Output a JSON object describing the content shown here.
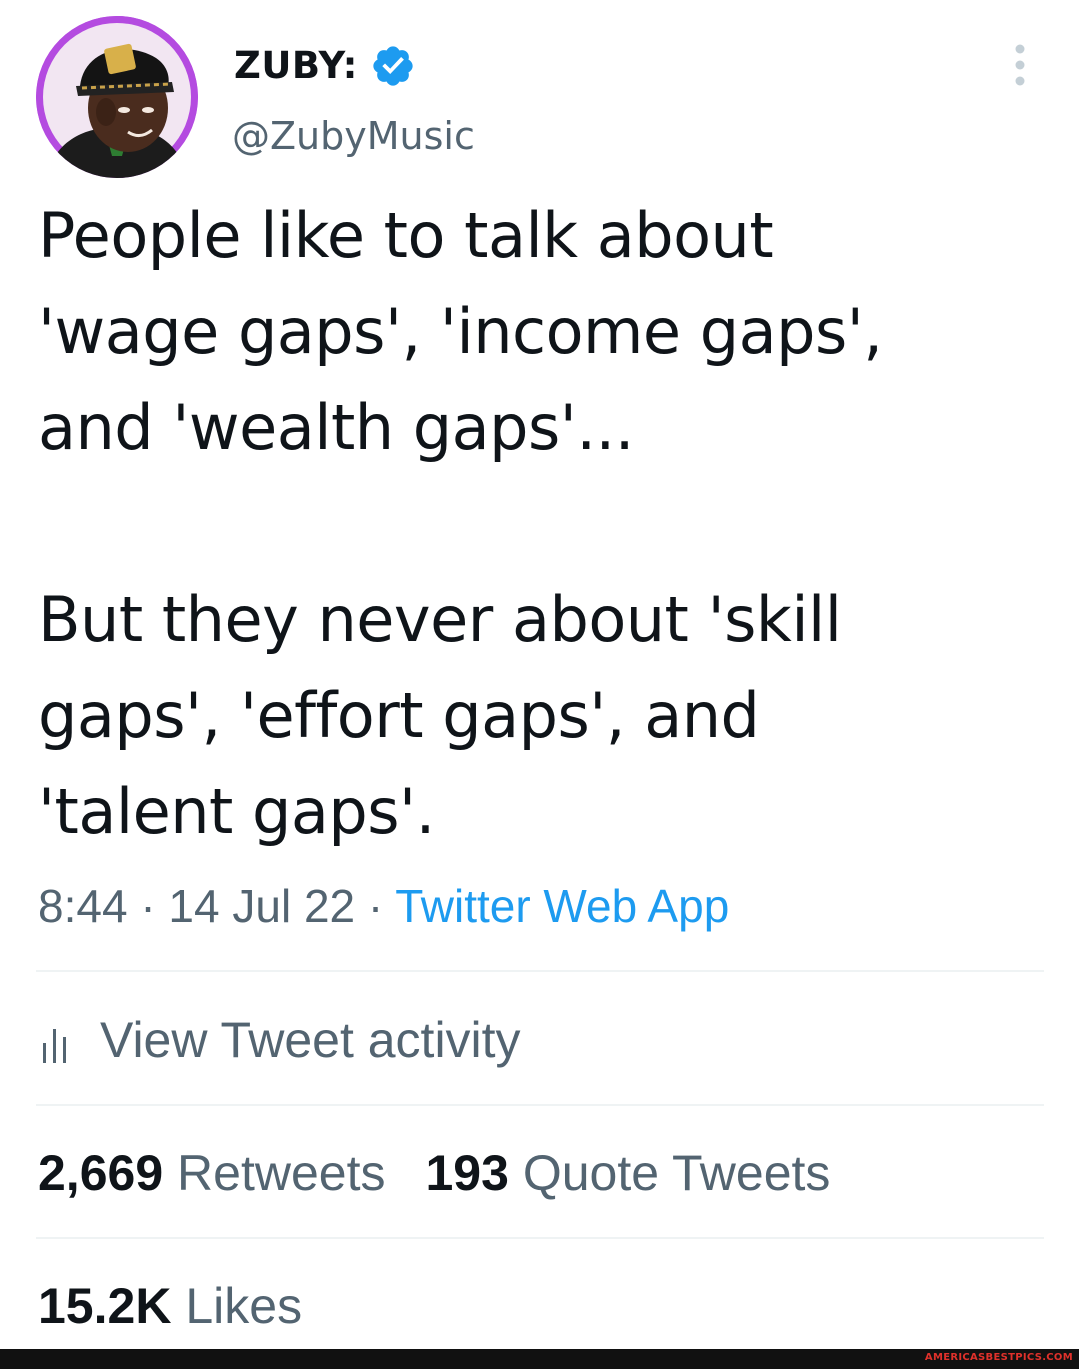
{
  "header": {
    "display_name": "ZUBY:",
    "handle": "@ZubyMusic",
    "verified_color": "#1d9bf0",
    "avatar_ring_color": "#b44be0",
    "more_icon": "more-vertical-icon"
  },
  "tweet": {
    "text": "People like to talk about\n'wage gaps', 'income gaps',\nand 'wealth gaps'...\n\nBut they never about 'skill\ngaps', 'effort gaps', and\n'talent gaps'.",
    "time": "8:44",
    "date": "14 Jul 22",
    "separator": "·",
    "source": "Twitter Web App"
  },
  "actions": {
    "view_activity_label": "View Tweet activity",
    "activity_icon": "bar-chart-icon"
  },
  "stats": {
    "retweets_count": "2,669",
    "retweets_label": "Retweets",
    "quotes_count": "193",
    "quotes_label": "Quote Tweets",
    "likes_count": "15.2K",
    "likes_label": "Likes"
  },
  "watermark": "AMERICASBESTPICS.COM",
  "colors": {
    "text_primary": "#0f1419",
    "text_secondary": "#536471",
    "link": "#1d9bf0",
    "divider": "#eff3f4"
  }
}
